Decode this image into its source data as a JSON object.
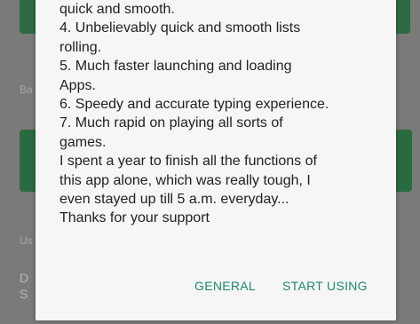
{
  "background": {
    "section_label_1": "Ba",
    "section_label_2": "Us",
    "row_text_line_1": "D",
    "row_text_line_2": "S"
  },
  "dialog": {
    "lines": [
      "quick and smooth.",
      "4. Unbelievably quick and smooth lists",
      "rolling.",
      "5. Much faster launching and loading",
      "Apps.",
      "6. Speedy and accurate typing experience.",
      "7. Much rapid on playing all sorts of",
      "games.",
      "I spent a year to finish all the functions of",
      "this app alone, which was really tough, I",
      "even stayed up till 5 a.m. everyday...",
      "Thanks for your support"
    ],
    "actions": {
      "general_label": "GENERAL",
      "start_using_label": "START USING"
    }
  },
  "colors": {
    "accent": "#1e8a6a",
    "dialog_background": "#f6f6f6",
    "background_card_green": "#2a6a40"
  }
}
